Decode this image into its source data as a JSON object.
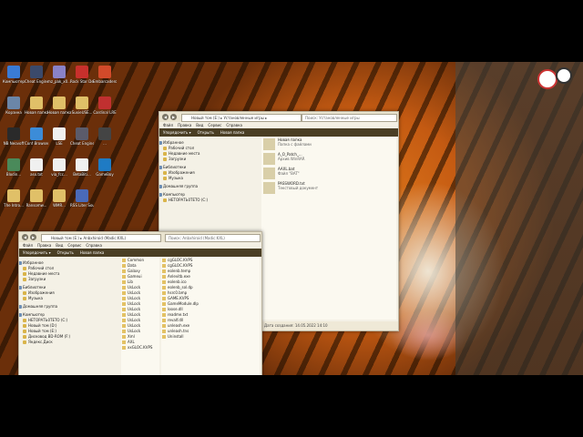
{
  "desktop_icons": [
    {
      "label": "Компьютер",
      "color": "#3a7bd5"
    },
    {
      "label": "Cheat Engine.exe",
      "color": "#3b4a6b"
    },
    {
      "label": "mz_pak_x0...",
      "color": "#8a82c8"
    },
    {
      "label": "Rock Star Dev-C++",
      "color": "#c8302c"
    },
    {
      "label": "Embarcadero Dev-C++",
      "color": "#d24a2a"
    },
    {
      "label": "Корзина",
      "color": "#6b86a8"
    },
    {
      "label": "Новая папка",
      "color": "#e0c068"
    },
    {
      "label": "Новая папка (2)",
      "color": "#e0c068"
    },
    {
      "label": "SuxieUSE...",
      "color": "#e0c068"
    },
    {
      "label": "Cardinal LRE",
      "color": "#c03030"
    },
    {
      "label": "NB Neovoff",
      "color": "#2a2a2a"
    },
    {
      "label": "Conf Browser.lnk",
      "color": "#3c8cd8"
    },
    {
      "label": "LSE",
      "color": "#f0f0f0"
    },
    {
      "label": "Cheat Engine",
      "color": "#5b5b6b"
    },
    {
      "label": "...",
      "color": "#444"
    },
    {
      "label": "Blodin...",
      "color": "#4a8a5a"
    },
    {
      "label": "asx.txt",
      "color": "#f0f0f0"
    },
    {
      "label": "via_fcc...",
      "color": "#f0f0f0"
    },
    {
      "label": "BetaBiti...",
      "color": "#f0f0f0"
    },
    {
      "label": "GameBoy",
      "color": "#1f7bc4"
    },
    {
      "label": "The Intro...",
      "color": "#e0c068"
    },
    {
      "label": "Ransomw...",
      "color": "#e0c068"
    },
    {
      "label": "WMR...",
      "color": "#e0c068"
    },
    {
      "label": "RSS Liter Soundtrack",
      "color": "#4a6ab8"
    }
  ],
  "window1": {
    "address": "Новый том (E:) ▸ Установленные игры ▸",
    "search": "Поиск: Установленные игры",
    "menu": [
      "Файл",
      "Правка",
      "Вид",
      "Сервис",
      "Справка"
    ],
    "toolbar": [
      "Упорядочить ▾",
      "Открыть",
      "Новая папка"
    ],
    "nav": [
      {
        "label": "Избранное",
        "group": true
      },
      {
        "label": "Рабочий стол",
        "group": false
      },
      {
        "label": "Недавние места",
        "group": false
      },
      {
        "label": "Загрузки",
        "group": false
      },
      {
        "label": "Библиотеки",
        "group": true
      },
      {
        "label": "Изображения",
        "group": false
      },
      {
        "label": "Музыка",
        "group": false
      },
      {
        "label": "Домашняя группа",
        "group": true
      },
      {
        "label": "Компьютер",
        "group": true
      },
      {
        "label": "НЕТОРАТЬ0ТЕТО (C:)",
        "group": false
      }
    ],
    "items": [
      {
        "name": "Новая папка",
        "meta": "Папка с файлами"
      },
      {
        "name": "A_O_Patch_...",
        "meta": "Архив WinRAR"
      },
      {
        "name": "AAXL.bat",
        "meta": "Файл \"BAT\""
      },
      {
        "name": "PASSWORD.txt",
        "meta": "Текстовый документ"
      }
    ],
    "status": "Дата создания: 14.05.2022 14:10"
  },
  "window2": {
    "address": "Новый том (E:) ▸ Anbxhiroid (Madic:KXL)",
    "search": "Поиск: Anbxhiroid (Madic:KXL)",
    "menu": [
      "Файл",
      "Правка",
      "Вид",
      "Сервис",
      "Справка"
    ],
    "toolbar": [
      "Упорядочить ▾",
      "Открыть",
      "Новая папка"
    ],
    "nav": [
      {
        "label": "Избранное",
        "group": true
      },
      {
        "label": "Рабочий стол",
        "group": false
      },
      {
        "label": "Недавние места",
        "group": false
      },
      {
        "label": "Загрузки",
        "group": false
      },
      {
        "label": "Библиотеки",
        "group": true
      },
      {
        "label": "Изображения",
        "group": false
      },
      {
        "label": "Музыка",
        "group": false
      },
      {
        "label": "Домашняя группа",
        "group": true
      },
      {
        "label": "Компьютер",
        "group": true
      },
      {
        "label": "НЕТОРАТЬ0ТЕТО (C:)",
        "group": false
      },
      {
        "label": "Новый том (D:)",
        "group": false
      },
      {
        "label": "Новый том (E:)",
        "group": false
      },
      {
        "label": "Дисковод BD-ROM (F:)",
        "group": false
      },
      {
        "label": "Яндекс.Диск",
        "group": false
      }
    ],
    "col1": [
      "Common",
      "Data",
      "Galaxy",
      "Gameui",
      "Lib",
      "UsLock",
      "UsLock",
      "UsLock",
      "UsLock",
      "UsLock",
      "UsLock",
      "UsLock",
      "UsLock",
      "UsLock",
      "Xml",
      "AXL",
      "xxGLOC.KVPS"
    ],
    "col2": [
      "cgGLOC.KVPS",
      "cgGLOC.KVPS",
      "eolenb.temp",
      "Anlevitb.exe",
      "eolenb.ico",
      "eolenb_sol.dp",
      "hsrc0.bmp",
      "GAME.KVPS",
      "GameModule.dlp",
      "loose.dll",
      "readme.txt",
      "revalf.dll",
      "unleash.exe",
      "unleash.tns",
      "Uninstall"
    ]
  }
}
